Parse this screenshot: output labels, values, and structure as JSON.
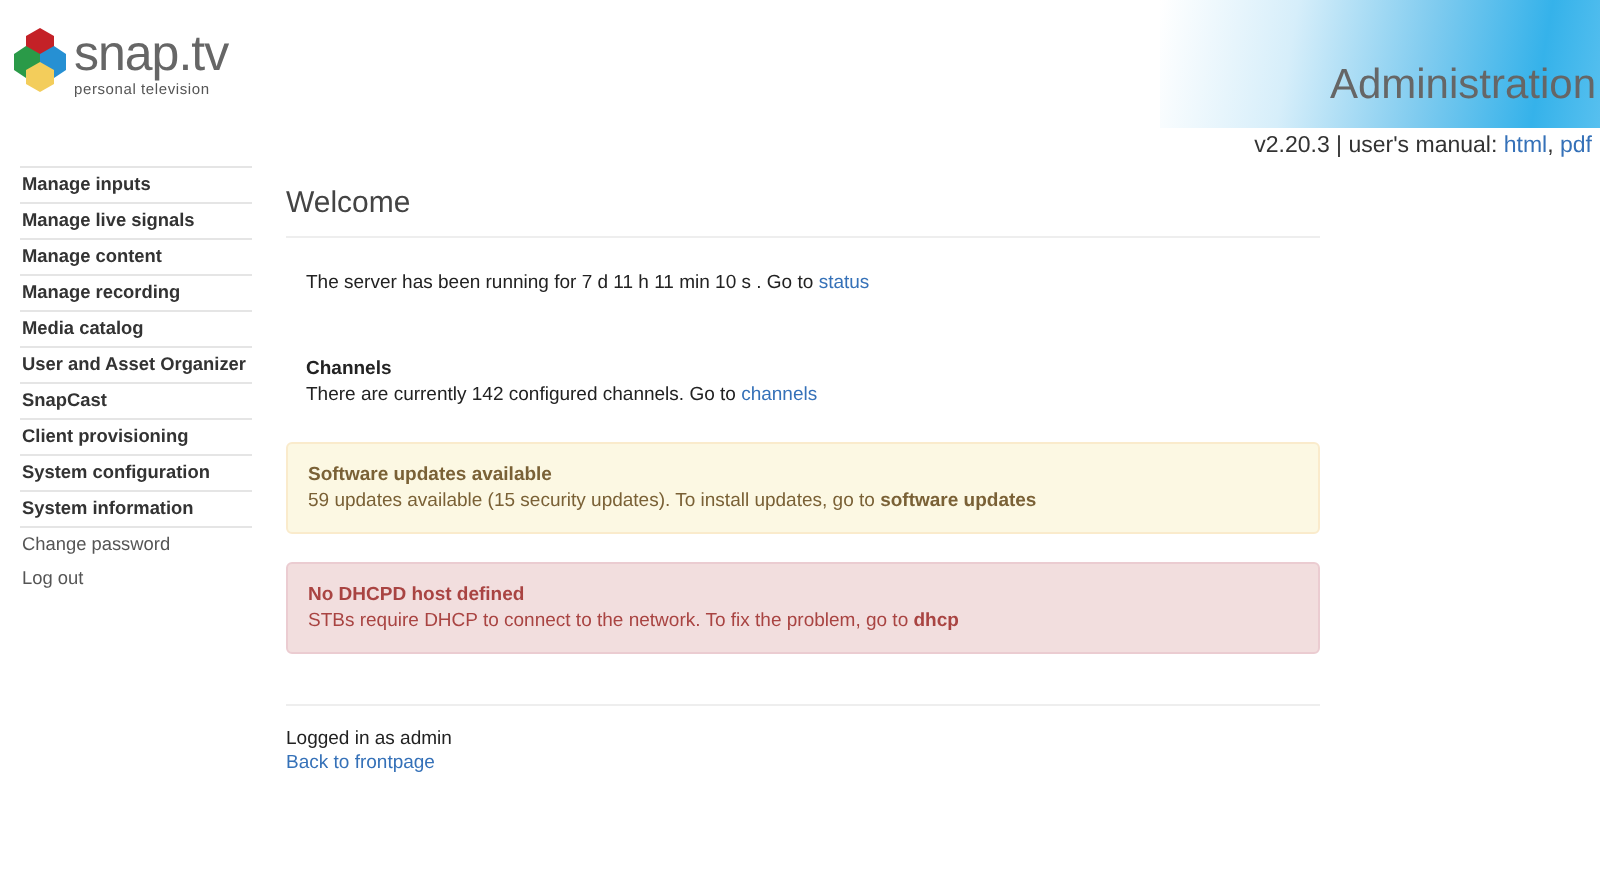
{
  "header": {
    "logo_name": "snap.tv",
    "logo_tagline": "personal television",
    "title": "Administration",
    "version": "v2.20.3 | user's manual:",
    "manual_links": [
      "html",
      "pdf"
    ],
    "link_separator": ","
  },
  "sidebar": {
    "items": [
      {
        "label": "Manage inputs",
        "kind": "section"
      },
      {
        "label": "Manage live signals",
        "kind": "section"
      },
      {
        "label": "Manage content",
        "kind": "section"
      },
      {
        "label": "Manage recording",
        "kind": "section"
      },
      {
        "label": "Media catalog",
        "kind": "section"
      },
      {
        "label": "User and Asset Organizer",
        "kind": "section"
      },
      {
        "label": "SnapCast",
        "kind": "section"
      },
      {
        "label": "Client provisioning",
        "kind": "section"
      },
      {
        "label": "System configuration",
        "kind": "section"
      },
      {
        "label": "System information",
        "kind": "section"
      },
      {
        "label": "Change password",
        "kind": "link"
      },
      {
        "label": "Log out",
        "kind": "link"
      }
    ]
  },
  "main": {
    "heading": "Welcome",
    "uptime": {
      "text": "The server has been running for 7 d 11 h 11 min 10 s . Go to",
      "link": "status"
    },
    "channels": {
      "title": "Channels",
      "text": "There are currently 142 configured channels. Go to",
      "link": "channels"
    },
    "alerts": [
      {
        "kind": "warning",
        "title": "Software updates available",
        "text": "59 updates available (15 security updates). To install updates, go to",
        "link": "software updates"
      },
      {
        "kind": "danger",
        "title": "No DHCPD host defined",
        "text": "STBs require DHCP to connect to the network. To fix the problem, go to",
        "link": "dhcp"
      }
    ],
    "footer": {
      "logged_in": "Logged in as admin",
      "link": "Back to frontpage"
    }
  }
}
